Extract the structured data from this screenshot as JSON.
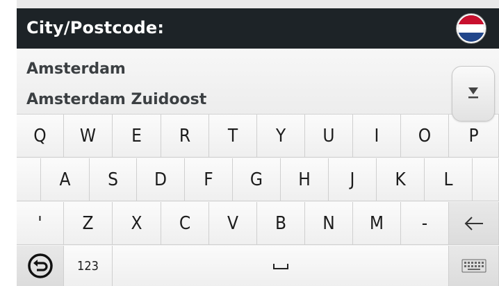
{
  "header": {
    "title": "City/Postcode:",
    "country_flag_icon": "netherlands-flag-icon",
    "flag_colors": [
      "#c8102e",
      "#ffffff",
      "#21468b"
    ]
  },
  "results": {
    "items": [
      "Amsterdam",
      "Amsterdam Zuidoost"
    ],
    "scroll_icon": "scroll-down-icon"
  },
  "keyboard": {
    "row1": [
      "Q",
      "W",
      "E",
      "R",
      "T",
      "Y",
      "U",
      "I",
      "O",
      "P"
    ],
    "row2": [
      "A",
      "S",
      "D",
      "F",
      "G",
      "H",
      "J",
      "K",
      "L"
    ],
    "row3": [
      "'",
      "Z",
      "X",
      "C",
      "V",
      "B",
      "N",
      "M",
      "-"
    ],
    "backspace_icon": "backspace-arrow-icon",
    "back_icon": "back-circle-icon",
    "numbers_label": "123",
    "space_icon": "space-bar-icon",
    "hide_keyboard_icon": "keyboard-icon"
  }
}
